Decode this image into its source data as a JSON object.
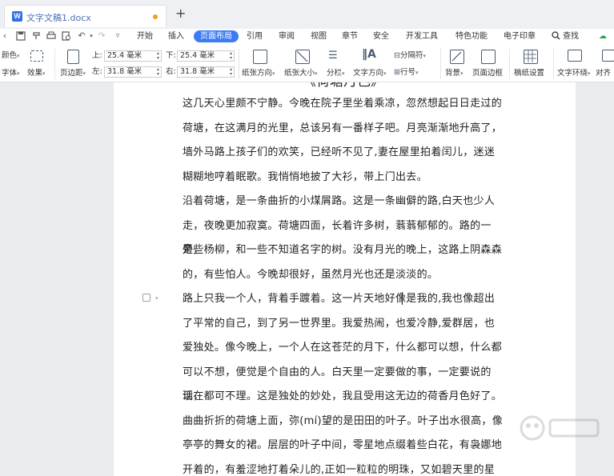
{
  "titlebar": {
    "doc_icon": "W",
    "doc_title": "文字文稿1.docx",
    "new_tab": "+"
  },
  "menubar": {
    "items": [
      "开始",
      "插入",
      "页面布局",
      "引用",
      "审阅",
      "视图",
      "章节",
      "安全",
      "开发工具",
      "特色功能",
      "电子印章",
      "查找"
    ],
    "active": "页面布局"
  },
  "ribbon": {
    "color": "颜色",
    "font": "字体",
    "effects": "效果",
    "margins": "页边距",
    "top_label": "上:",
    "top_value": "25.4 毫米",
    "bottom_label": "下:",
    "bottom_value": "25.4 毫米",
    "left_label": "左:",
    "left_value": "31.8 毫米",
    "right_label": "右:",
    "right_value": "31.8 毫米",
    "orientation": "纸张方向",
    "size": "纸张大小",
    "columns": "分栏",
    "text_direction": "文字方向",
    "breaks": "分隔符",
    "line_numbers": "行号",
    "background": "背景",
    "page_border": "页面边框",
    "manuscript": "稿纸设置",
    "wrap": "文字环绕",
    "align": "对齐"
  },
  "document": {
    "heading_fragment": "《荷塘月色》",
    "paragraphs": [
      [
        "这几天心里颇不宁静。今晚在院子里坐着乘凉，忽然想起日日走过的",
        "荷塘，在这满月的光里，总该另有一番样子吧。月亮渐渐地升高了，",
        "墙外马路上孩子们的欢笑，已经听不见了,妻在屋里拍着闰儿，迷迷",
        "糊糊地哼着眠歌。我悄悄地披了大衫，带上门出去。"
      ],
      [
        "沿着荷塘，是一条曲折的小煤屑路。这是一条幽僻的路,白天也少人",
        "走，夜晚更加寂寞。荷塘四面，长着许多树，蓊蓊郁郁的。路的一旁，",
        "是些杨柳，和一些不知道名字的树。没有月光的晚上，这路上阴森森",
        "的，有些怕人。今晚却很好，虽然月光也还是淡淡的。"
      ],
      [
        "路上只我一个人，背着手踱着。这一片天地好像是我的,我也像超出",
        "了平常的自己，到了另一世界里。我爱热闹，也爱冷静,爱群居，也",
        "爱独处。像今晚上，一个人在这苍茫的月下，什么都可以想，什么都",
        "可以不想，便觉是个自由的人。白天里一定要做的事，一定要说的话，",
        "现在都可不理。这是独处的妙处，我且受用这无边的荷香月色好了。"
      ],
      [
        "曲曲折折的荷塘上面，弥(mí)望的是田田的叶子。叶子出水很高，像",
        "亭亭的舞女的裙。层层的叶子中间，零星地点缀着些白花，有袅娜地",
        "开着的，有羞涩地打着朵儿的,正如一粒粒的明珠，又如碧天里的星"
      ]
    ]
  },
  "colors": {
    "accent": "#3b7bf6",
    "page": "#ffffff",
    "canvas": "#e9ebee"
  }
}
